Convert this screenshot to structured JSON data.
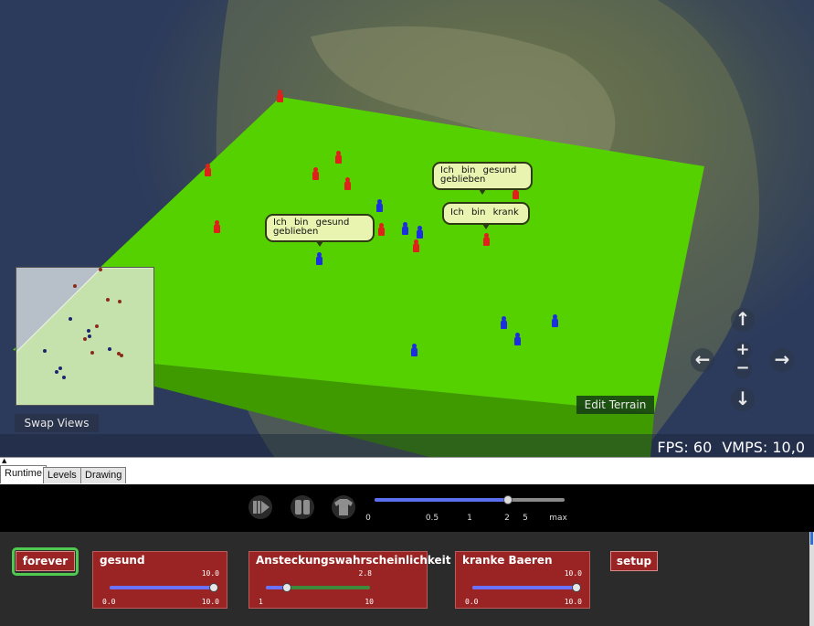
{
  "viewport": {
    "swap_views_label": "Swap Views",
    "edit_terrain_label": "Edit Terrain",
    "fps_text": "FPS: 60",
    "vmps_text": "VMPS: 10,0",
    "bubbles": [
      {
        "line1": "Ich bin gesund",
        "line2": "geblieben"
      },
      {
        "line1": "Ich bin gesund",
        "line2": "geblieben"
      },
      {
        "line1": "Ich bin krank",
        "line2": ""
      }
    ],
    "nav_icons": [
      "up-arrow-icon",
      "down-arrow-icon",
      "left-arrow-icon",
      "right-arrow-icon",
      "zoom-in-icon",
      "zoom-out-icon"
    ],
    "colors": {
      "terrain": "#56d100",
      "healthy_agent": "#1c2fe0",
      "sick_agent": "#e0201a"
    }
  },
  "tabs": [
    {
      "label": "Runtime",
      "active": true
    },
    {
      "label": "Levels",
      "active": false
    },
    {
      "label": "Drawing",
      "active": false
    }
  ],
  "controls": {
    "icons": [
      "step-icon",
      "pause-icon",
      "shirt-icon"
    ],
    "speed_ticks": [
      "0",
      "0.5",
      "1",
      "2",
      "5",
      "max"
    ],
    "speed_fraction": 0.7
  },
  "blocks": {
    "forever_label": "forever",
    "setup_label": "setup",
    "sliders": [
      {
        "label": "gesund",
        "current": "10.0",
        "min": "0.0",
        "max": "10.0",
        "fraction": 1.0
      },
      {
        "label": "Ansteckungswahrscheinlichkeit",
        "current": "2.8",
        "min": "1",
        "max": "10",
        "fraction": 0.2
      },
      {
        "label": "kranke Baeren",
        "current": "10.0",
        "min": "0.0",
        "max": "10.0",
        "fraction": 1.0
      }
    ]
  }
}
